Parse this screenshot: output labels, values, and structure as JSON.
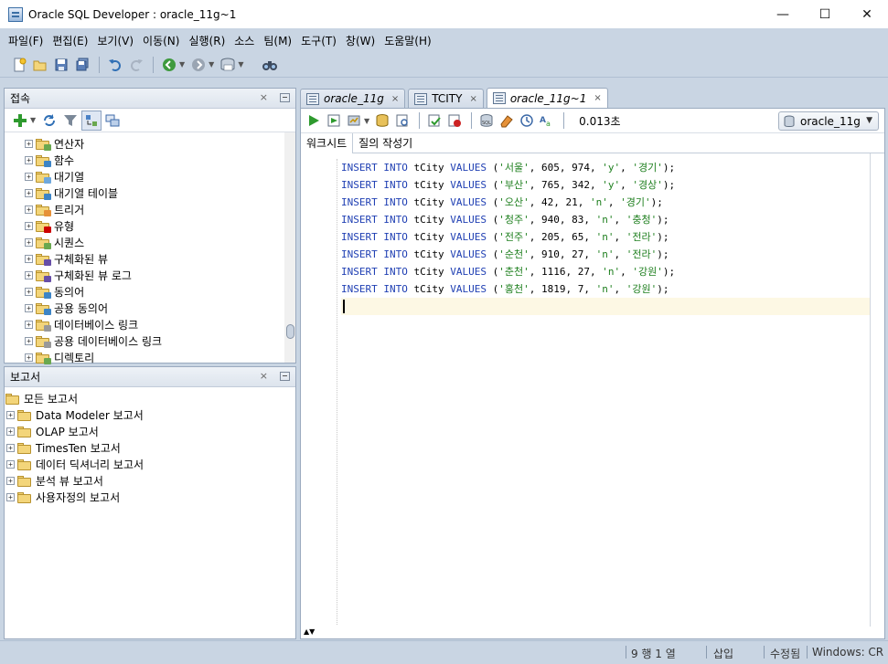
{
  "window": {
    "title": "Oracle SQL Developer : oracle_11g~1",
    "controls": [
      "—",
      "☐",
      "✕"
    ]
  },
  "menubar": {
    "items": [
      "파일(F)",
      "편집(E)",
      "보기(V)",
      "이동(N)",
      "실행(R)",
      "소스",
      "팀(M)",
      "도구(T)",
      "창(W)",
      "도움말(H)"
    ]
  },
  "connections_panel": {
    "title": "접속",
    "close": "×",
    "tree": [
      {
        "label": "연산자",
        "badge": "#6aa84f"
      },
      {
        "label": "함수",
        "badge": "#3d85c6"
      },
      {
        "label": "대기열",
        "badge": "#6fa8dc"
      },
      {
        "label": "대기열 테이블",
        "badge": "#3d85c6"
      },
      {
        "label": "트리거",
        "badge": "#e69138"
      },
      {
        "label": "유형",
        "badge": "#cc0000"
      },
      {
        "label": "시퀀스",
        "badge": "#6aa84f"
      },
      {
        "label": "구체화된 뷰",
        "badge": "#674ea7"
      },
      {
        "label": "구체화된 뷰 로그",
        "badge": "#674ea7"
      },
      {
        "label": "동의어",
        "badge": "#3d85c6"
      },
      {
        "label": "공용 동의어",
        "badge": "#3d85c6"
      },
      {
        "label": "데이터베이스 링크",
        "badge": "#999999"
      },
      {
        "label": "공용 데이터베이스 링크",
        "badge": "#999999"
      },
      {
        "label": "디렉토리",
        "badge": "#6aa84f"
      }
    ]
  },
  "reports_panel": {
    "title": "보고서",
    "close": "×",
    "root": "모든 보고서",
    "tree": [
      {
        "label": "Data Modeler 보고서"
      },
      {
        "label": "OLAP 보고서"
      },
      {
        "label": "TimesTen 보고서"
      },
      {
        "label": "데이터 딕셔너리 보고서"
      },
      {
        "label": "분석 뷰 보고서"
      },
      {
        "label": "사용자정의 보고서"
      }
    ]
  },
  "editor": {
    "tabs": [
      {
        "label": "oracle_11g",
        "italic": true,
        "active": false
      },
      {
        "label": "TCITY",
        "italic": false,
        "active": false
      },
      {
        "label": "oracle_11g~1",
        "italic": true,
        "active": true
      }
    ],
    "tab_close": "×",
    "elapsed": "0.013초",
    "connection": "oracle_11g",
    "sub_tabs": [
      "워크시트",
      "질의 작성기"
    ],
    "code": [
      {
        "kw": "INSERT INTO",
        "table": " tCity ",
        "kw2": "VALUES",
        "open": " (",
        "city": "'서울'",
        "a": ", 605, 974, ",
        "f": "'y'",
        "sep": ", ",
        "region": "'경기'",
        "end": ");"
      },
      {
        "kw": "INSERT INTO",
        "table": " tCity ",
        "kw2": "VALUES",
        "open": " (",
        "city": "'부산'",
        "a": ", 765, 342, ",
        "f": "'y'",
        "sep": ", ",
        "region": "'경상'",
        "end": ");"
      },
      {
        "kw": "INSERT INTO",
        "table": " tCity ",
        "kw2": "VALUES",
        "open": " (",
        "city": "'오산'",
        "a": ", 42, 21, ",
        "f": "'n'",
        "sep": ", ",
        "region": "'경기'",
        "end": ");"
      },
      {
        "kw": "INSERT INTO",
        "table": " tCity ",
        "kw2": "VALUES",
        "open": " (",
        "city": "'청주'",
        "a": ", 940, 83, ",
        "f": "'n'",
        "sep": ", ",
        "region": "'충청'",
        "end": ");"
      },
      {
        "kw": "INSERT INTO",
        "table": " tCity ",
        "kw2": "VALUES",
        "open": " (",
        "city": "'전주'",
        "a": ", 205, 65, ",
        "f": "'n'",
        "sep": ", ",
        "region": "'전라'",
        "end": ");"
      },
      {
        "kw": "INSERT INTO",
        "table": " tCity ",
        "kw2": "VALUES",
        "open": " (",
        "city": "'순천'",
        "a": ", 910, 27, ",
        "f": "'n'",
        "sep": ", ",
        "region": "'전라'",
        "end": ");"
      },
      {
        "kw": "INSERT INTO",
        "table": " tCity ",
        "kw2": "VALUES",
        "open": " (",
        "city": "'춘천'",
        "a": ", 1116, 27, ",
        "f": "'n'",
        "sep": ", ",
        "region": "'강원'",
        "end": ");"
      },
      {
        "kw": "INSERT INTO",
        "table": " tCity ",
        "kw2": "VALUES",
        "open": " (",
        "city": "'홍천'",
        "a": ", 1819, 7, ",
        "f": "'n'",
        "sep": ", ",
        "region": "'강원'",
        "end": ");"
      }
    ],
    "scroll_arrows": "▲▼"
  },
  "statusbar": {
    "position": "9 행 1 열",
    "mode": "삽입",
    "state": "수정됨",
    "line_ending": "Windows: CR"
  },
  "colors": {
    "chrome": "#c9d5e3",
    "keyword": "#1f3fb3",
    "string": "#1e7f1e",
    "current_line": "#fdf8e4"
  }
}
